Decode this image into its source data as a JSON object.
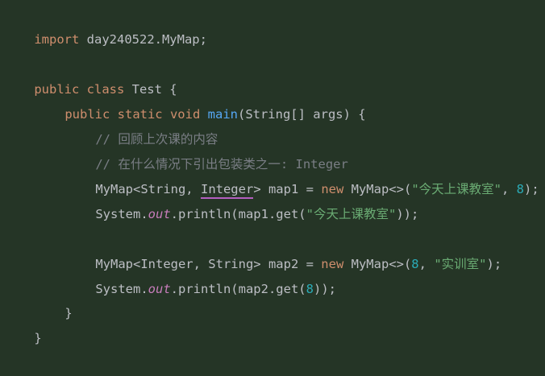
{
  "code": {
    "lines": [
      {
        "tokens": [
          {
            "t": "import",
            "c": "kw"
          },
          {
            "t": " day240522.MyMap;",
            "c": "plain"
          }
        ]
      },
      {
        "tokens": []
      },
      {
        "tokens": [
          {
            "t": "public class",
            "c": "kw"
          },
          {
            "t": " Test {",
            "c": "plain"
          }
        ]
      },
      {
        "tokens": [
          {
            "t": "public static void",
            "c": "kw"
          },
          {
            "t": " ",
            "c": "plain"
          },
          {
            "t": "main",
            "c": "fn"
          },
          {
            "t": "(String[] args) {",
            "c": "plain"
          }
        ]
      },
      {
        "tokens": [
          {
            "t": "// 回顾上次课的内容",
            "c": "cmt"
          }
        ]
      },
      {
        "tokens": [
          {
            "t": "// 在什么情况下引出包装类之一: Integer",
            "c": "cmt"
          }
        ]
      },
      {
        "tokens": [
          {
            "t": "MyMap<String, ",
            "c": "plain"
          },
          {
            "t": "Integer",
            "c": "plain"
          },
          {
            "t": "> map1 = ",
            "c": "plain"
          },
          {
            "t": "new",
            "c": "kw"
          },
          {
            "t": " MyMap<>(",
            "c": "plain"
          },
          {
            "t": "\"今天上课教室\"",
            "c": "str"
          },
          {
            "t": ", ",
            "c": "plain"
          },
          {
            "t": "8",
            "c": "num"
          },
          {
            "t": ");",
            "c": "plain"
          }
        ]
      },
      {
        "tokens": [
          {
            "t": "System.",
            "c": "plain"
          },
          {
            "t": "out",
            "c": "static-field"
          },
          {
            "t": ".println(map1.get(",
            "c": "plain"
          },
          {
            "t": "\"今天上课教室\"",
            "c": "str"
          },
          {
            "t": "));",
            "c": "plain"
          }
        ]
      },
      {
        "tokens": []
      },
      {
        "tokens": [
          {
            "t": "MyMap<Integer, String> map2 = ",
            "c": "plain"
          },
          {
            "t": "new",
            "c": "kw"
          },
          {
            "t": " MyMap<>(",
            "c": "plain"
          },
          {
            "t": "8",
            "c": "num"
          },
          {
            "t": ", ",
            "c": "plain"
          },
          {
            "t": "\"实训室\"",
            "c": "str"
          },
          {
            "t": ");",
            "c": "plain"
          }
        ]
      },
      {
        "tokens": [
          {
            "t": "System.",
            "c": "plain"
          },
          {
            "t": "out",
            "c": "static-field"
          },
          {
            "t": ".println(map2.get(",
            "c": "plain"
          },
          {
            "t": "8",
            "c": "num"
          },
          {
            "t": "));",
            "c": "plain"
          }
        ]
      },
      {
        "tokens": [
          {
            "t": "}",
            "c": "plain"
          }
        ]
      },
      {
        "tokens": [
          {
            "t": "}",
            "c": "plain"
          }
        ]
      }
    ]
  },
  "colors": {
    "background": "#253526",
    "keyword": "#cf8e6d",
    "plain": "#bcbec4",
    "function": "#56a8f5",
    "comment": "#7a7e85",
    "string": "#6aab73",
    "number": "#2aacb8",
    "static_field": "#c77dbb",
    "underline": "#b35fbf"
  }
}
